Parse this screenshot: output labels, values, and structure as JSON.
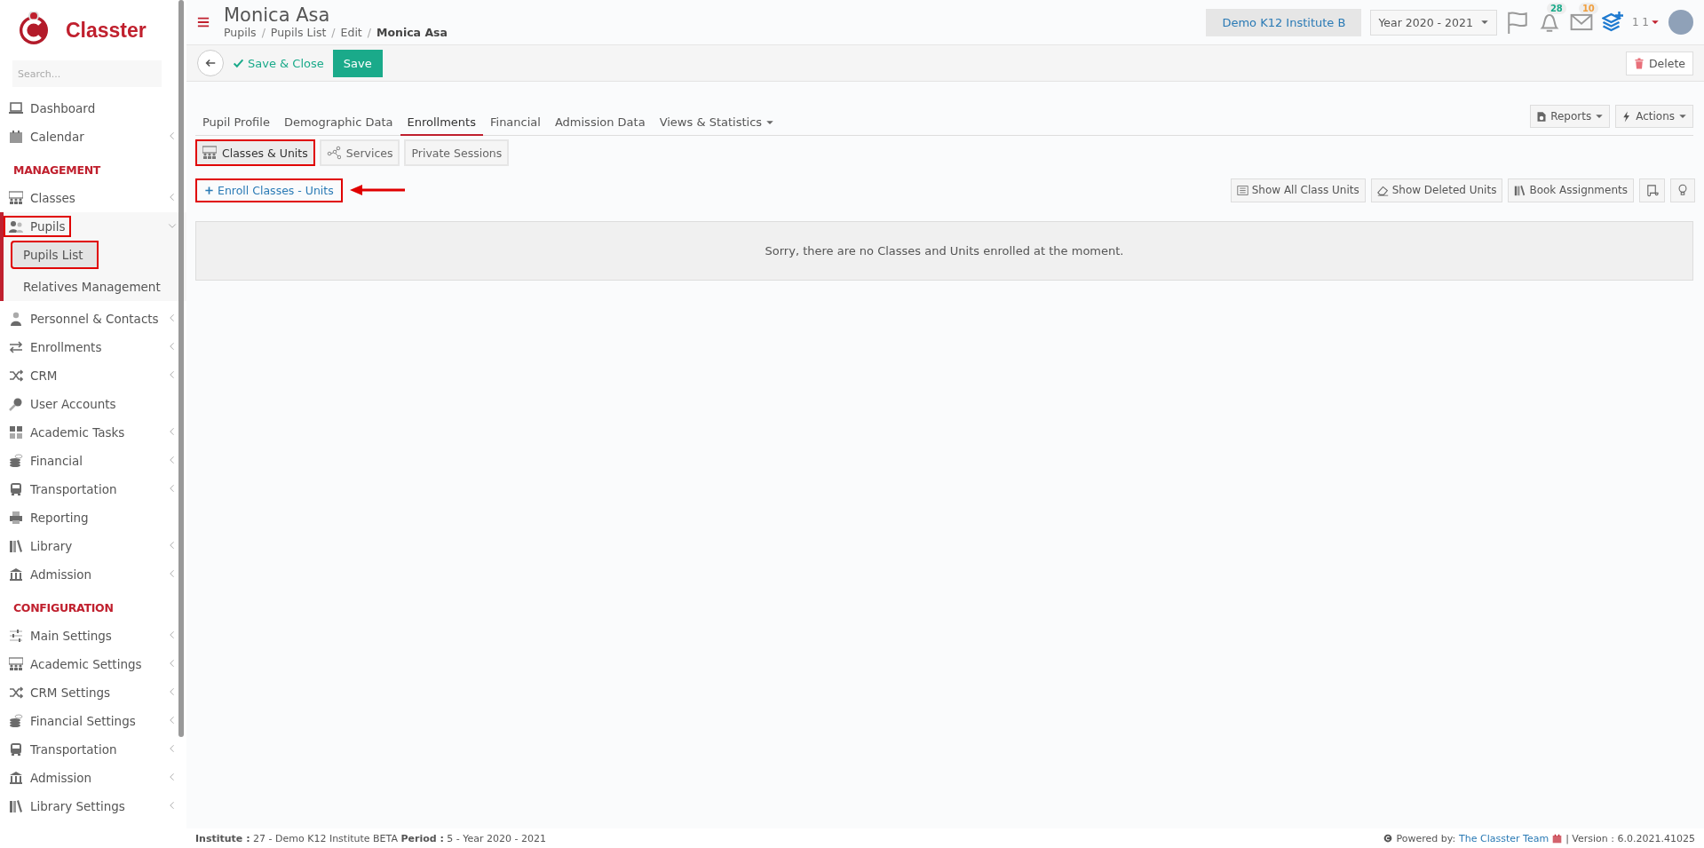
{
  "brand": {
    "name": "Classter"
  },
  "sidebar": {
    "search": {
      "placeholder": "Search..."
    },
    "groups": [
      {
        "items": [
          {
            "label": "Dashboard",
            "has_submenu": false,
            "expanded": false,
            "highlighted": false
          },
          {
            "label": "Calendar",
            "has_submenu": true,
            "expanded": false,
            "highlighted": false
          }
        ]
      },
      {
        "heading": "MANAGEMENT",
        "items": [
          {
            "label": "Classes",
            "has_submenu": true,
            "expanded": false,
            "highlighted": false
          },
          {
            "label": "Pupils",
            "has_submenu": true,
            "expanded": true,
            "highlighted": true,
            "children": [
              {
                "label": "Pupils List",
                "selected": true,
                "highlighted": true
              },
              {
                "label": "Relatives Management",
                "selected": false,
                "highlighted": false
              }
            ]
          },
          {
            "label": "Personnel & Contacts",
            "has_submenu": true,
            "expanded": false,
            "highlighted": false
          },
          {
            "label": "Enrollments",
            "has_submenu": true,
            "expanded": false,
            "highlighted": false
          },
          {
            "label": "CRM",
            "has_submenu": true,
            "expanded": false,
            "highlighted": false
          },
          {
            "label": "User Accounts",
            "has_submenu": false,
            "expanded": false,
            "highlighted": false
          },
          {
            "label": "Academic Tasks",
            "has_submenu": true,
            "expanded": false,
            "highlighted": false
          },
          {
            "label": "Financial",
            "has_submenu": true,
            "expanded": false,
            "highlighted": false
          },
          {
            "label": "Transportation",
            "has_submenu": true,
            "expanded": false,
            "highlighted": false
          },
          {
            "label": "Reporting",
            "has_submenu": false,
            "expanded": false,
            "highlighted": false
          },
          {
            "label": "Library",
            "has_submenu": true,
            "expanded": false,
            "highlighted": false
          },
          {
            "label": "Admission",
            "has_submenu": true,
            "expanded": false,
            "highlighted": false
          }
        ]
      },
      {
        "heading": "CONFIGURATION",
        "items": [
          {
            "label": "Main Settings",
            "has_submenu": true,
            "expanded": false,
            "highlighted": false
          },
          {
            "label": "Academic Settings",
            "has_submenu": true,
            "expanded": false,
            "highlighted": false
          },
          {
            "label": "CRM Settings",
            "has_submenu": true,
            "expanded": false,
            "highlighted": false
          },
          {
            "label": "Financial Settings",
            "has_submenu": true,
            "expanded": false,
            "highlighted": false
          },
          {
            "label": "Transportation",
            "has_submenu": true,
            "expanded": false,
            "highlighted": false
          },
          {
            "label": "Admission",
            "has_submenu": true,
            "expanded": false,
            "highlighted": false
          },
          {
            "label": "Library Settings",
            "has_submenu": true,
            "expanded": false,
            "highlighted": false
          }
        ]
      }
    ]
  },
  "header": {
    "title": "Monica Asa",
    "breadcrumbs": [
      {
        "label": "Pupils",
        "current": false
      },
      {
        "label": "Pupils List",
        "current": false
      },
      {
        "label": "Edit",
        "current": false
      },
      {
        "label": "Monica Asa",
        "current": true
      }
    ],
    "separator": "/",
    "institute": "Demo K12 Institute B",
    "year": "Year 2020 - 2021",
    "badges": [
      {
        "kind": "bell",
        "count": "28",
        "color": "#1aaa8a"
      },
      {
        "kind": "envelope",
        "count": "10",
        "color": "#f0a040"
      }
    ],
    "user": "1 1"
  },
  "toolbar": {
    "save_close": "Save & Close",
    "save": "Save",
    "delete": "Delete"
  },
  "tabs": [
    {
      "label": "Pupil Profile",
      "selected": false,
      "dropdown": false
    },
    {
      "label": "Demographic Data",
      "selected": false,
      "dropdown": false
    },
    {
      "label": "Enrollments",
      "selected": true,
      "dropdown": false
    },
    {
      "label": "Financial",
      "selected": false,
      "dropdown": false
    },
    {
      "label": "Admission Data",
      "selected": false,
      "dropdown": false
    },
    {
      "label": "Views & Statistics",
      "selected": false,
      "dropdown": true
    }
  ],
  "tab_actions": [
    "Reports",
    "Actions"
  ],
  "subtabs": [
    {
      "label": "Classes & Units",
      "selected": true,
      "highlighted": true
    },
    {
      "label": "Services",
      "selected": false,
      "highlighted": false
    },
    {
      "label": "Private Sessions",
      "selected": false,
      "highlighted": false
    }
  ],
  "enroll_link": {
    "label": "Enroll Classes - Units",
    "highlighted": true
  },
  "tools": [
    "Show All Class Units",
    "Show Deleted Units",
    "Book Assignments"
  ],
  "empty_message": "Sorry, there are no Classes and Units enrolled at the moment.",
  "footer": {
    "info": "**Institute :** 27 - Demo K12 Institute BETA **Period :** 5 - Year 2020 - 2021",
    "powered": "Powered by:",
    "team": "The Classter Team",
    "version": "| Version : 6.0.2021.41025"
  }
}
